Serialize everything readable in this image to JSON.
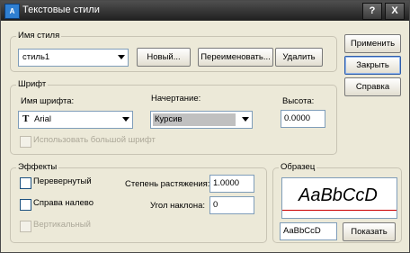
{
  "window": {
    "title": "Текстовые стили",
    "help_btn": "?",
    "close_btn": "X"
  },
  "style_group": {
    "label": "Имя стиля",
    "selected_style": "стиль1",
    "new_button": "Новый...",
    "rename_button": "Переименовать...",
    "delete_button": "Удалить"
  },
  "side_buttons": {
    "apply": "Применить",
    "close": "Закрыть",
    "help": "Справка"
  },
  "font_group": {
    "label": "Шрифт",
    "font_name_label": "Имя шрифта:",
    "font_name_value": "Arial",
    "font_style_label": "Начертание:",
    "font_style_value": "Курсив",
    "height_label": "Высота:",
    "height_value": "0.0000",
    "big_font_label": "Использовать большой шрифт"
  },
  "effects_group": {
    "label": "Эффекты",
    "upside_down_label": "Перевернутый",
    "backwards_label": "Справа налево",
    "vertical_label": "Вертикальный",
    "width_factor_label": "Степень растяжения:",
    "width_factor_value": "1.0000",
    "oblique_label": "Угол наклона:",
    "oblique_value": "0"
  },
  "preview_group": {
    "label": "Образец",
    "sample_text": "AaBbCcD",
    "input_value": "AaBbCcD",
    "show_button": "Показать"
  },
  "colors": {
    "title_bar": "#2b2b2b",
    "dialog_bg": "#ece9d8",
    "selection": "#c0c0c0",
    "baseline": "#cc0000"
  }
}
